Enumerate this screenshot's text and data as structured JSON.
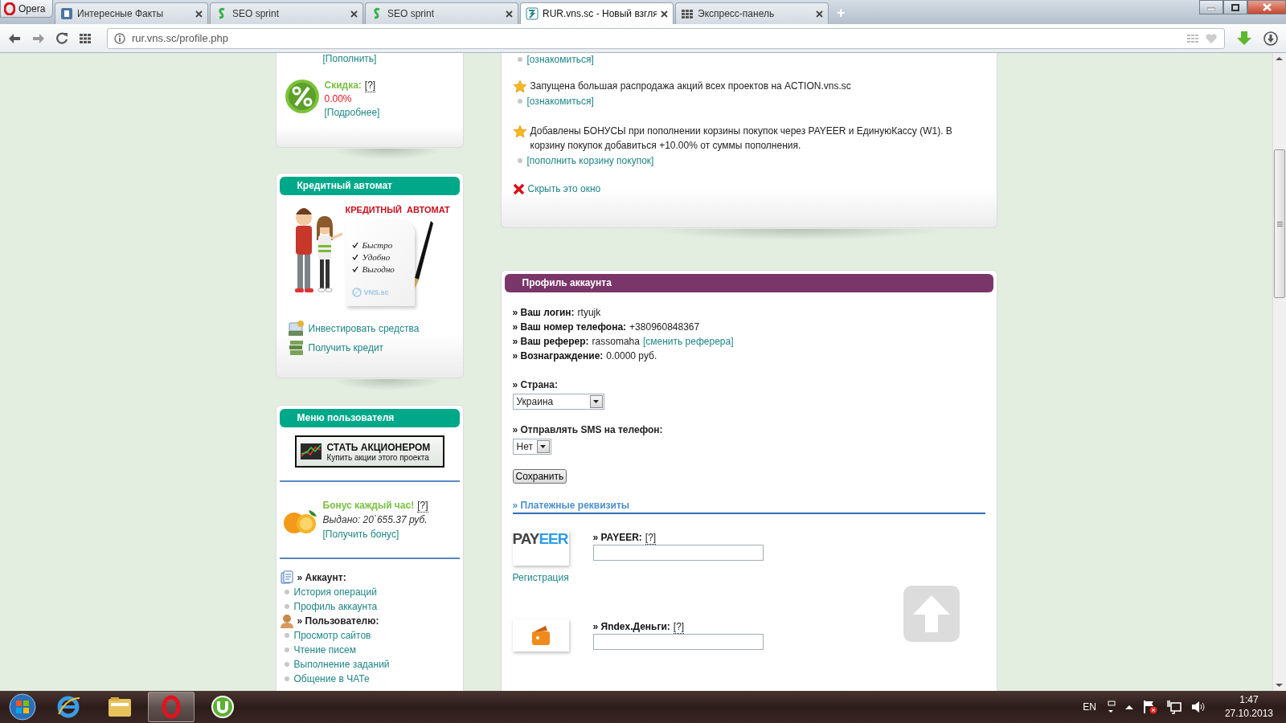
{
  "browser": {
    "menu_label": "Opera",
    "tabs": [
      {
        "title": "Интересные Факты",
        "selected": false
      },
      {
        "title": "SEO sprint",
        "selected": false
      },
      {
        "title": "SEO sprint",
        "selected": false
      },
      {
        "title": "RUR.vns.sc - Новый взгля",
        "selected": true
      },
      {
        "title": "Экспресс-панель",
        "selected": false
      }
    ],
    "new_tab": "+",
    "address": "rur.vns.sc/profile.php"
  },
  "sidebar": {
    "discount": {
      "top_link": "[Пополнить]",
      "label": "Скидка:",
      "help": "[?]",
      "value": "0.00%",
      "more": "[Подробнее]"
    },
    "credit": {
      "title": "Кредитный автомат",
      "banner_title": "КРЕДИТНЫЙ  АВТОМАТ",
      "banner_items": [
        "Быстро",
        "Удобно",
        "Выгодно"
      ],
      "banner_brand": "VNS.sc",
      "links": [
        "Инвестировать средства",
        "Получить кредит"
      ]
    },
    "user_menu": {
      "title": "Меню пользователя",
      "promo": {
        "title": "СТАТЬ АКЦИОНЕРОМ",
        "subtitle": "Купить акции этого проекта"
      },
      "bonus": {
        "title": "Бонус каждый час!",
        "help": "[?]",
        "issued": "Выдано: 20`655.37 руб.",
        "link": "[Получить бонус]"
      },
      "groups": [
        {
          "kind": "account",
          "title": "» Аккаунт:",
          "items": [
            "История операций",
            "Профиль аккаунта"
          ]
        },
        {
          "kind": "user",
          "title": "» Пользователю:",
          "items": [
            "Просмотр сайтов",
            "Чтение писем",
            "Выполнение заданий",
            "Общение в ЧАТе"
          ]
        }
      ]
    }
  },
  "news": {
    "top_link": "[ознакомиться]",
    "items": [
      {
        "text": "Запущена большая распродажа акций всех проектов на ACTION.vns.sc",
        "link": "[ознакомиться]"
      },
      {
        "text": "Добавлены БОНУСЫ при пополнении корзины покупок через PAYEER и ЕдинуюКассу (W1). В корзину покупок добавиться +10.00% от суммы пополнения.",
        "link": "[пополнить корзину покупок]"
      }
    ],
    "hide": "Скрыть это окно"
  },
  "profile": {
    "title": "Профиль аккаунта",
    "fields": [
      {
        "label": "» Ваш логин:",
        "value": "rtyujk"
      },
      {
        "label": "» Ваш номер телефона:",
        "value": "+380960848367"
      },
      {
        "label": "» Ваш реферер:",
        "value": "rassomaha",
        "link": "[сменить реферера]"
      },
      {
        "label": "» Вознаграждение:",
        "value": "0.0000 руб."
      }
    ],
    "country": {
      "label": "» Страна:",
      "value": "Украина"
    },
    "sms": {
      "label": "» Отправлять SMS на телефон:",
      "value": "Нет"
    },
    "save": "Сохранить",
    "payments_title": "» Платежные реквизиты",
    "payments": [
      {
        "kind": "payeer",
        "label": "» PAYEER:",
        "help": "[?]",
        "logo": [
          "PAY",
          "EER"
        ],
        "link": "Регистрация"
      },
      {
        "kind": "yandex",
        "label": "» Яndex.Деньги:",
        "help": "[?]"
      }
    ]
  },
  "taskbar": {
    "language": "EN",
    "time": "1:47",
    "date": "27.10.2013"
  }
}
